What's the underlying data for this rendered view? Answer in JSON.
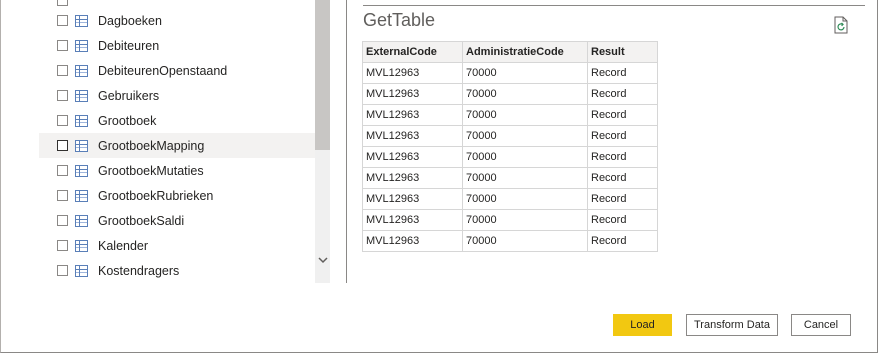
{
  "navigator": {
    "items": [
      {
        "label": "Dagboeken"
      },
      {
        "label": "Debiteuren"
      },
      {
        "label": "DebiteurenOpenstaand"
      },
      {
        "label": "Gebruikers"
      },
      {
        "label": "Grootboek"
      },
      {
        "label": "GrootboekMapping"
      },
      {
        "label": "GrootboekMutaties"
      },
      {
        "label": "GrootboekRubrieken"
      },
      {
        "label": "GrootboekSaldi"
      },
      {
        "label": "Kalender"
      },
      {
        "label": "Kostendragers"
      }
    ]
  },
  "preview": {
    "title": "GetTable",
    "columns": [
      "ExternalCode",
      "AdministratieCode",
      "Result"
    ],
    "rows": [
      [
        "MVL12963",
        "70000",
        "Record"
      ],
      [
        "MVL12963",
        "70000",
        "Record"
      ],
      [
        "MVL12963",
        "70000",
        "Record"
      ],
      [
        "MVL12963",
        "70000",
        "Record"
      ],
      [
        "MVL12963",
        "70000",
        "Record"
      ],
      [
        "MVL12963",
        "70000",
        "Record"
      ],
      [
        "MVL12963",
        "70000",
        "Record"
      ],
      [
        "MVL12963",
        "70000",
        "Record"
      ],
      [
        "MVL12963",
        "70000",
        "Record"
      ]
    ]
  },
  "buttons": {
    "load": "Load",
    "transform": "Transform Data",
    "cancel": "Cancel"
  },
  "colors": {
    "accent": "#f2c811"
  }
}
